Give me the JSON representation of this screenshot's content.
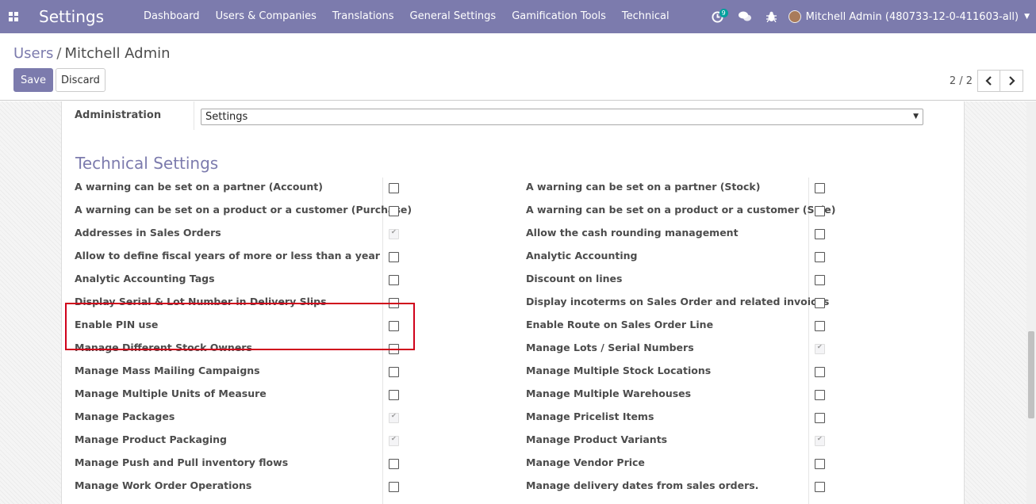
{
  "app": {
    "title": "Settings",
    "menu": [
      "Dashboard",
      "Users & Companies",
      "Translations",
      "General Settings",
      "Gamification Tools",
      "Technical"
    ],
    "activity_badge": "9",
    "user": "Mitchell Admin (480733-12-0-411603-all)"
  },
  "control_panel": {
    "breadcrumb_parent": "Users",
    "breadcrumb_separator": "/",
    "breadcrumb_current": "Mitchell Admin",
    "save_label": "Save",
    "discard_label": "Discard",
    "pager": "2 / 2"
  },
  "form": {
    "administration_label": "Administration",
    "administration_value": "Settings",
    "section_title": "Technical Settings",
    "left": [
      {
        "label": "A warning can be set on a partner (Account)",
        "checked": false
      },
      {
        "label": "A warning can be set on a product or a customer (Purchase)",
        "checked": false
      },
      {
        "label": "Addresses in Sales Orders",
        "checked": true
      },
      {
        "label": "Allow to define fiscal years of more or less than a year",
        "checked": false
      },
      {
        "label": "Analytic Accounting Tags",
        "checked": false
      },
      {
        "label": "Display Serial & Lot Number in Delivery Slips",
        "checked": false
      },
      {
        "label": "Enable PIN use",
        "checked": false
      },
      {
        "label": "Manage Different Stock Owners",
        "checked": false
      },
      {
        "label": "Manage Mass Mailing Campaigns",
        "checked": false
      },
      {
        "label": "Manage Multiple Units of Measure",
        "checked": false
      },
      {
        "label": "Manage Packages",
        "checked": true
      },
      {
        "label": "Manage Product Packaging",
        "checked": true
      },
      {
        "label": "Manage Push and Pull inventory flows",
        "checked": false
      },
      {
        "label": "Manage Work Order Operations",
        "checked": false
      }
    ],
    "right": [
      {
        "label": "A warning can be set on a partner (Stock)",
        "checked": false
      },
      {
        "label": "A warning can be set on a product or a customer (Sale)",
        "checked": false
      },
      {
        "label": "Allow the cash rounding management",
        "checked": false
      },
      {
        "label": "Analytic Accounting",
        "checked": false
      },
      {
        "label": "Discount on lines",
        "checked": false
      },
      {
        "label": "Display incoterms on Sales Order and related invoices",
        "checked": false
      },
      {
        "label": "Enable Route on Sales Order Line",
        "checked": false
      },
      {
        "label": "Manage Lots / Serial Numbers",
        "checked": true
      },
      {
        "label": "Manage Multiple Stock Locations",
        "checked": false
      },
      {
        "label": "Manage Multiple Warehouses",
        "checked": false
      },
      {
        "label": "Manage Pricelist Items",
        "checked": false
      },
      {
        "label": "Manage Product Variants",
        "checked": true
      },
      {
        "label": "Manage Vendor Price",
        "checked": false
      },
      {
        "label": "Manage delivery dates from sales orders.",
        "checked": false
      }
    ]
  }
}
